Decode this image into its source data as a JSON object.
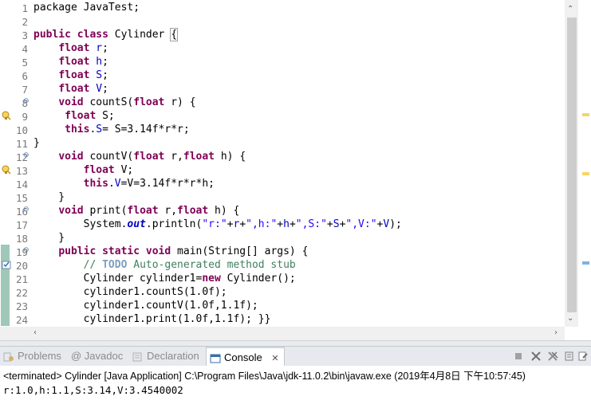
{
  "editor": {
    "lines": [
      {
        "no": "1",
        "segments": [
          {
            "t": "package JavaTest;",
            "c": ""
          }
        ]
      },
      {
        "no": "2",
        "segments": []
      },
      {
        "no": "3",
        "segments": [
          {
            "t": "public",
            "c": "kw"
          },
          {
            "t": " ",
            "c": ""
          },
          {
            "t": "class",
            "c": "kw"
          },
          {
            "t": " Cylinder ",
            "c": ""
          },
          {
            "t": "{",
            "c": "brace-box"
          }
        ]
      },
      {
        "no": "4",
        "segments": [
          {
            "t": "    ",
            "c": ""
          },
          {
            "t": "float",
            "c": "kw"
          },
          {
            "t": " ",
            "c": ""
          },
          {
            "t": "r",
            "c": "fld"
          },
          {
            "t": ";",
            "c": ""
          }
        ]
      },
      {
        "no": "5",
        "segments": [
          {
            "t": "    ",
            "c": ""
          },
          {
            "t": "float",
            "c": "kw"
          },
          {
            "t": " ",
            "c": ""
          },
          {
            "t": "h",
            "c": "fld"
          },
          {
            "t": ";",
            "c": ""
          }
        ]
      },
      {
        "no": "6",
        "segments": [
          {
            "t": "    ",
            "c": ""
          },
          {
            "t": "float",
            "c": "kw"
          },
          {
            "t": " ",
            "c": ""
          },
          {
            "t": "S",
            "c": "fld"
          },
          {
            "t": ";",
            "c": ""
          }
        ]
      },
      {
        "no": "7",
        "segments": [
          {
            "t": "    ",
            "c": ""
          },
          {
            "t": "float",
            "c": "kw"
          },
          {
            "t": " ",
            "c": ""
          },
          {
            "t": "V",
            "c": "fld"
          },
          {
            "t": ";",
            "c": ""
          }
        ]
      },
      {
        "no": "8",
        "fold": true,
        "segments": [
          {
            "t": "    ",
            "c": ""
          },
          {
            "t": "void",
            "c": "kw"
          },
          {
            "t": " countS(",
            "c": ""
          },
          {
            "t": "float",
            "c": "kw"
          },
          {
            "t": " r) {",
            "c": ""
          }
        ]
      },
      {
        "no": "9",
        "warn": true,
        "segments": [
          {
            "t": "     ",
            "c": ""
          },
          {
            "t": "float",
            "c": "kw"
          },
          {
            "t": " S;",
            "c": ""
          }
        ]
      },
      {
        "no": "10",
        "segments": [
          {
            "t": "     ",
            "c": ""
          },
          {
            "t": "this",
            "c": "kw"
          },
          {
            "t": ".",
            "c": ""
          },
          {
            "t": "S",
            "c": "fld"
          },
          {
            "t": "= S=3.14f*r*r;",
            "c": ""
          }
        ]
      },
      {
        "no": "11",
        "segments": [
          {
            "t": "}",
            "c": ""
          }
        ]
      },
      {
        "no": "12",
        "fold": true,
        "segments": [
          {
            "t": "    ",
            "c": ""
          },
          {
            "t": "void",
            "c": "kw"
          },
          {
            "t": " countV(",
            "c": ""
          },
          {
            "t": "float",
            "c": "kw"
          },
          {
            "t": " r,",
            "c": ""
          },
          {
            "t": "float",
            "c": "kw"
          },
          {
            "t": " h) {",
            "c": ""
          }
        ]
      },
      {
        "no": "13",
        "warn": true,
        "segments": [
          {
            "t": "        ",
            "c": ""
          },
          {
            "t": "float",
            "c": "kw"
          },
          {
            "t": " V;",
            "c": ""
          }
        ]
      },
      {
        "no": "14",
        "segments": [
          {
            "t": "        ",
            "c": ""
          },
          {
            "t": "this",
            "c": "kw"
          },
          {
            "t": ".",
            "c": ""
          },
          {
            "t": "V",
            "c": "fld"
          },
          {
            "t": "=V=3.14f*r*r*h;",
            "c": ""
          }
        ]
      },
      {
        "no": "15",
        "segments": [
          {
            "t": "    }",
            "c": ""
          }
        ]
      },
      {
        "no": "16",
        "fold": true,
        "segments": [
          {
            "t": "    ",
            "c": ""
          },
          {
            "t": "void",
            "c": "kw"
          },
          {
            "t": " print(",
            "c": ""
          },
          {
            "t": "float",
            "c": "kw"
          },
          {
            "t": " r,",
            "c": ""
          },
          {
            "t": "float",
            "c": "kw"
          },
          {
            "t": " h) {",
            "c": ""
          }
        ]
      },
      {
        "no": "17",
        "segments": [
          {
            "t": "        System.",
            "c": ""
          },
          {
            "t": "out",
            "c": "static"
          },
          {
            "t": ".println(",
            "c": ""
          },
          {
            "t": "\"r:\"",
            "c": "str"
          },
          {
            "t": "+",
            "c": ""
          },
          {
            "t": "r",
            "c": "fld"
          },
          {
            "t": "+",
            "c": ""
          },
          {
            "t": "\",h:\"",
            "c": "str"
          },
          {
            "t": "+",
            "c": ""
          },
          {
            "t": "h",
            "c": "fld"
          },
          {
            "t": "+",
            "c": ""
          },
          {
            "t": "\",S:\"",
            "c": "str"
          },
          {
            "t": "+",
            "c": ""
          },
          {
            "t": "S",
            "c": "fld"
          },
          {
            "t": "+",
            "c": ""
          },
          {
            "t": "\",V:\"",
            "c": "str"
          },
          {
            "t": "+",
            "c": ""
          },
          {
            "t": "V",
            "c": "fld"
          },
          {
            "t": ");",
            "c": ""
          }
        ]
      },
      {
        "no": "18",
        "segments": [
          {
            "t": "    }",
            "c": ""
          }
        ]
      },
      {
        "no": "19",
        "fold": true,
        "bar": true,
        "segments": [
          {
            "t": "    ",
            "c": ""
          },
          {
            "t": "public",
            "c": "kw"
          },
          {
            "t": " ",
            "c": ""
          },
          {
            "t": "static",
            "c": "kw"
          },
          {
            "t": " ",
            "c": ""
          },
          {
            "t": "void",
            "c": "kw"
          },
          {
            "t": " main(String[] args) {",
            "c": ""
          }
        ]
      },
      {
        "no": "20",
        "task": true,
        "bar": true,
        "segments": [
          {
            "t": "        ",
            "c": ""
          },
          {
            "t": "// ",
            "c": "cmt"
          },
          {
            "t": "TODO",
            "c": "todo"
          },
          {
            "t": " Auto-generated method stub",
            "c": "cmt"
          }
        ]
      },
      {
        "no": "21",
        "bar": true,
        "segments": [
          {
            "t": "        Cylinder cylinder1=",
            "c": ""
          },
          {
            "t": "new",
            "c": "kw"
          },
          {
            "t": " Cylinder();",
            "c": ""
          }
        ]
      },
      {
        "no": "22",
        "bar": true,
        "segments": [
          {
            "t": "        cylinder1.countS(1.0f);",
            "c": ""
          }
        ]
      },
      {
        "no": "23",
        "bar": true,
        "segments": [
          {
            "t": "        cylinder1.countV(1.0f,1.1f);",
            "c": ""
          }
        ]
      },
      {
        "no": "24",
        "bar": true,
        "current": true,
        "segments": [
          {
            "t": "        cylinder1.print(1.0f,1.1f); }}",
            "c": ""
          }
        ]
      }
    ]
  },
  "bottom_panel": {
    "tabs": [
      {
        "label": "Problems",
        "icon": "problems-icon",
        "active": false
      },
      {
        "label": "@ Javadoc",
        "icon": "javadoc-icon",
        "active": false
      },
      {
        "label": "Declaration",
        "icon": "declaration-icon",
        "active": false
      },
      {
        "label": "Console",
        "icon": "console-icon",
        "active": true,
        "close": "✕"
      }
    ],
    "console_header": "<terminated> Cylinder [Java Application] C:\\Program Files\\Java\\jdk-11.0.2\\bin\\javaw.exe (2019年4月8日 下午10:57:45)",
    "console_output": "r:1.0,h:1.1,S:3.14,V:3.4540002"
  },
  "colors": {
    "keyword": "#7f0055",
    "field": "#0000c0",
    "string": "#2a00ff",
    "comment": "#3f7f5f"
  }
}
